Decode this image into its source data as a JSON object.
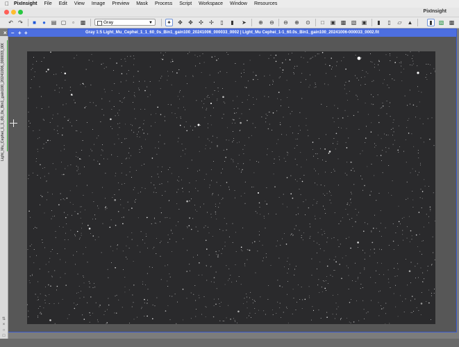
{
  "menubar": {
    "apple_icon": "apple-icon",
    "items": [
      "PixInsight",
      "File",
      "Edit",
      "View",
      "Image",
      "Preview",
      "Mask",
      "Process",
      "Script",
      "Workspace",
      "Window",
      "Resources"
    ]
  },
  "window": {
    "app_title": "PixInsight",
    "traffic_colors": {
      "close": "#fe5f57",
      "minimize": "#febc2e",
      "zoom": "#28c840"
    }
  },
  "toolbar": {
    "channel_select": "Gray",
    "icons": [
      "undo-icon",
      "redo-icon",
      "new-image-icon",
      "open-icon",
      "save-icon",
      "close-image-icon",
      "readout-icon",
      "zoom-fit-icon",
      "pan-icon",
      "center-icon",
      "new-preview-icon",
      "edit-preview-icon",
      "select-icon",
      "zoom-in-icon",
      "zoom-out-icon",
      "zoom-1-1-icon",
      "zoom-2-1-icon",
      "zoom-window-icon",
      "fit-window-icon",
      "stf-icon",
      "screen-transfer-icon"
    ]
  },
  "image_window": {
    "title": "Gray 1:5 Light_Mu_Cephei_1_1_60_0s_Bin1_gain100_20241006_000033_0002 | Light_Mu Cephei_1-1_60.0s_Bin1_gain100_20241006-000033_0002.fit",
    "controls": [
      "×",
      "–",
      "+",
      "+"
    ],
    "side_tab_label": "Light_Mu_Cephei_1_1_60_0s_Bin1_gain100_20241006_000033_0002",
    "background_color": "#2a2a2c",
    "accent_color": "#4d6fe0"
  }
}
